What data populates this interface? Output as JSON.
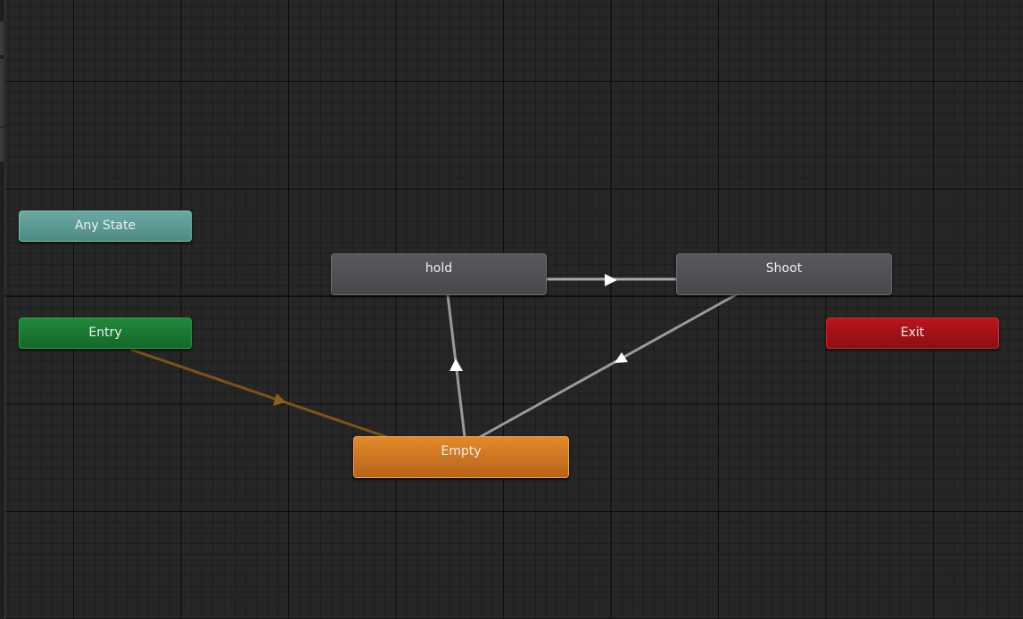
{
  "graph": {
    "nodes": {
      "any_state": "Any State",
      "entry": "Entry",
      "exit": "Exit",
      "hold": "hold",
      "shoot": "Shoot",
      "empty": "Empty"
    },
    "colors": {
      "background": "#262626",
      "any_state": "#5b9a92",
      "entry": "#198035",
      "exit": "#a81218",
      "state": "#505154",
      "default_state": "#d07822",
      "default_transition": "#7a5516",
      "transition": "#b4b4b4"
    }
  }
}
